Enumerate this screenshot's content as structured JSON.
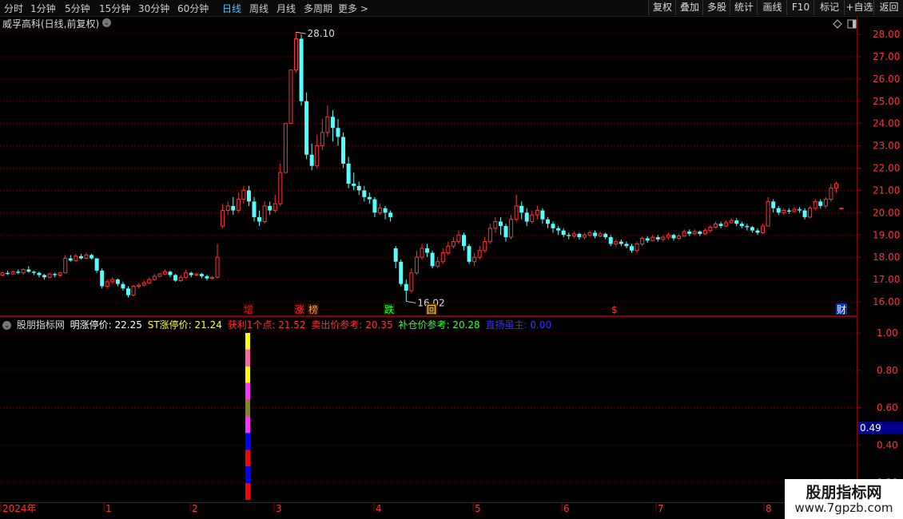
{
  "toolbar": {
    "timeframes": [
      "分时",
      "1分钟",
      "5分钟",
      "15分钟",
      "30分钟",
      "60分钟",
      "日线",
      "周线",
      "月线",
      "多周期",
      "更多"
    ],
    "active_timeframe": "日线",
    "more_arrow": ">",
    "buttons": [
      "复权",
      "叠加",
      "多股",
      "统计",
      "画线",
      "F10",
      "标记",
      "+自选",
      "返回"
    ]
  },
  "header": {
    "stock_title": "威孚高科(日线,前复权)",
    "dropdown_glyph": "⌄",
    "diamond_icon": "diamond-icon",
    "panel_icon": "panel-icon"
  },
  "price_axis": {
    "labels": [
      "28.00",
      "27.00",
      "26.00",
      "25.00",
      "24.00",
      "23.00",
      "22.00",
      "21.00",
      "20.00",
      "19.00",
      "18.00",
      "17.00",
      "16.00"
    ],
    "range": [
      15.5,
      28.6
    ]
  },
  "annotations": {
    "high_label": "28.10",
    "low_label": "16.02",
    "event_marks": [
      {
        "text": "增",
        "color": "#cc2222",
        "bg": "#2a0000"
      },
      {
        "text": "涨",
        "color": "#ff3333",
        "bg": "#2a0000"
      },
      {
        "text": "榜",
        "color": "#ff9944",
        "bg": "#2a1000"
      },
      {
        "text": "跌",
        "color": "#33ff33",
        "bg": "#002a00"
      },
      {
        "text": "回",
        "color": "#ffcc66",
        "bg": "#553300"
      },
      {
        "text": "$",
        "color": "#ff3333",
        "bg": "#000000"
      },
      {
        "text": "财",
        "color": "#ffffff",
        "bg": "#0033cc"
      }
    ]
  },
  "indicator": {
    "name": "股朋指标网",
    "items": [
      {
        "label": "明涨停价: 22.25",
        "color": "#ffffff"
      },
      {
        "label": "ST涨停价: 21.24",
        "color": "#ffff33"
      },
      {
        "label": "获利1个点: 21.52",
        "color": "#ff3333"
      },
      {
        "label": "卖出价参考: 20.35",
        "color": "#ff3333"
      },
      {
        "label": "补仓价参考: 20.28",
        "color": "#33ff33"
      },
      {
        "label": "直扬虽主: 0.00",
        "color": "#3333ff"
      }
    ],
    "axis_labels": [
      "1.00",
      "0.80",
      "0.60",
      "0.40",
      "0.20"
    ],
    "current_value": "0.49",
    "bar_colors": [
      "#ffff00",
      "#ff66aa",
      "#ffff00",
      "#ff33ff",
      "#888822",
      "#ff33ff",
      "#0000ff",
      "#ff0000",
      "#0000ff",
      "#ff0000"
    ]
  },
  "time_axis": {
    "labels": [
      "2024年",
      "1",
      "2",
      "3",
      "4",
      "5",
      "6",
      "7",
      "8"
    ]
  },
  "chart_data": {
    "type": "candlestick",
    "ylim": [
      15.5,
      28.6
    ],
    "candles": [
      {
        "o": 17.2,
        "c": 17.3,
        "h": 17.35,
        "l": 17.15
      },
      {
        "o": 17.3,
        "c": 17.25,
        "h": 17.4,
        "l": 17.2
      },
      {
        "o": 17.25,
        "c": 17.35,
        "h": 17.4,
        "l": 17.2
      },
      {
        "o": 17.35,
        "c": 17.3,
        "h": 17.45,
        "l": 17.25
      },
      {
        "o": 17.3,
        "c": 17.45,
        "h": 17.5,
        "l": 17.2
      },
      {
        "o": 17.45,
        "c": 17.35,
        "h": 17.6,
        "l": 17.3
      },
      {
        "o": 17.35,
        "c": 17.3,
        "h": 17.4,
        "l": 17.2
      },
      {
        "o": 17.3,
        "c": 17.2,
        "h": 17.35,
        "l": 17.1
      },
      {
        "o": 17.2,
        "c": 17.1,
        "h": 17.25,
        "l": 17.0
      },
      {
        "o": 17.1,
        "c": 17.25,
        "h": 17.3,
        "l": 17.05
      },
      {
        "o": 17.25,
        "c": 17.2,
        "h": 17.3,
        "l": 17.1
      },
      {
        "o": 17.2,
        "c": 17.3,
        "h": 17.35,
        "l": 17.1
      },
      {
        "o": 17.3,
        "c": 17.95,
        "h": 18.1,
        "l": 17.3
      },
      {
        "o": 17.95,
        "c": 17.85,
        "h": 18.1,
        "l": 17.8
      },
      {
        "o": 17.85,
        "c": 18.05,
        "h": 18.15,
        "l": 17.8
      },
      {
        "o": 18.05,
        "c": 17.95,
        "h": 18.15,
        "l": 17.9
      },
      {
        "o": 17.95,
        "c": 18.1,
        "h": 18.2,
        "l": 17.9
      },
      {
        "o": 18.1,
        "c": 17.95,
        "h": 18.15,
        "l": 17.9
      },
      {
        "o": 17.95,
        "c": 17.4,
        "h": 17.95,
        "l": 17.3
      },
      {
        "o": 17.4,
        "c": 16.7,
        "h": 17.5,
        "l": 16.6
      },
      {
        "o": 16.7,
        "c": 16.9,
        "h": 17.0,
        "l": 16.6
      },
      {
        "o": 16.9,
        "c": 17.0,
        "h": 17.1,
        "l": 16.8
      },
      {
        "o": 17.0,
        "c": 16.8,
        "h": 17.05,
        "l": 16.7
      },
      {
        "o": 16.8,
        "c": 16.6,
        "h": 16.9,
        "l": 16.5
      },
      {
        "o": 16.6,
        "c": 16.3,
        "h": 16.7,
        "l": 16.2
      },
      {
        "o": 16.3,
        "c": 16.7,
        "h": 16.75,
        "l": 16.25
      },
      {
        "o": 16.7,
        "c": 16.75,
        "h": 16.85,
        "l": 16.6
      },
      {
        "o": 16.75,
        "c": 16.85,
        "h": 16.95,
        "l": 16.7
      },
      {
        "o": 16.85,
        "c": 17.0,
        "h": 17.1,
        "l": 16.8
      },
      {
        "o": 17.0,
        "c": 17.15,
        "h": 17.25,
        "l": 16.95
      },
      {
        "o": 17.15,
        "c": 17.25,
        "h": 17.3,
        "l": 17.1
      },
      {
        "o": 17.25,
        "c": 17.35,
        "h": 17.45,
        "l": 17.2
      },
      {
        "o": 17.35,
        "c": 17.2,
        "h": 17.4,
        "l": 17.1
      },
      {
        "o": 17.2,
        "c": 16.95,
        "h": 17.25,
        "l": 16.9
      },
      {
        "o": 16.95,
        "c": 17.1,
        "h": 17.2,
        "l": 16.9
      },
      {
        "o": 17.1,
        "c": 17.3,
        "h": 17.45,
        "l": 17.05
      },
      {
        "o": 17.3,
        "c": 17.2,
        "h": 17.35,
        "l": 17.1
      },
      {
        "o": 17.2,
        "c": 17.25,
        "h": 17.3,
        "l": 17.15
      },
      {
        "o": 17.25,
        "c": 17.15,
        "h": 17.3,
        "l": 17.05
      },
      {
        "o": 17.15,
        "c": 17.05,
        "h": 17.2,
        "l": 16.95
      },
      {
        "o": 17.05,
        "c": 17.1,
        "h": 17.15,
        "l": 17.0
      },
      {
        "o": 17.1,
        "c": 18.0,
        "h": 18.6,
        "l": 17.05
      },
      {
        "o": 19.4,
        "c": 20.1,
        "h": 20.4,
        "l": 19.3
      },
      {
        "o": 20.1,
        "c": 20.3,
        "h": 20.5,
        "l": 19.9
      },
      {
        "o": 20.3,
        "c": 20.1,
        "h": 20.7,
        "l": 19.9
      },
      {
        "o": 20.1,
        "c": 20.6,
        "h": 20.9,
        "l": 20.0
      },
      {
        "o": 20.6,
        "c": 21.0,
        "h": 21.2,
        "l": 20.4
      },
      {
        "o": 21.0,
        "c": 20.5,
        "h": 21.2,
        "l": 20.3
      },
      {
        "o": 20.5,
        "c": 19.8,
        "h": 20.7,
        "l": 19.6
      },
      {
        "o": 19.8,
        "c": 19.6,
        "h": 20.1,
        "l": 19.4
      },
      {
        "o": 19.6,
        "c": 20.3,
        "h": 20.5,
        "l": 19.5
      },
      {
        "o": 20.3,
        "c": 20.1,
        "h": 20.5,
        "l": 19.9
      },
      {
        "o": 20.1,
        "c": 20.4,
        "h": 20.8,
        "l": 20.0
      },
      {
        "o": 20.4,
        "c": 21.8,
        "h": 22.2,
        "l": 20.3
      },
      {
        "o": 21.8,
        "c": 24.0,
        "h": 24.0,
        "l": 21.8
      },
      {
        "o": 24.0,
        "c": 26.4,
        "h": 26.4,
        "l": 24.0
      },
      {
        "o": 26.4,
        "c": 27.8,
        "h": 28.1,
        "l": 26.3
      },
      {
        "o": 27.8,
        "c": 25.0,
        "h": 28.0,
        "l": 24.8
      },
      {
        "o": 25.0,
        "c": 22.6,
        "h": 25.4,
        "l": 22.4
      },
      {
        "o": 22.6,
        "c": 22.1,
        "h": 23.1,
        "l": 21.9
      },
      {
        "o": 22.1,
        "c": 23.0,
        "h": 23.5,
        "l": 22.0
      },
      {
        "o": 23.0,
        "c": 23.6,
        "h": 24.2,
        "l": 22.8
      },
      {
        "o": 23.6,
        "c": 24.3,
        "h": 24.8,
        "l": 23.4
      },
      {
        "o": 24.3,
        "c": 23.8,
        "h": 24.6,
        "l": 23.2
      },
      {
        "o": 23.8,
        "c": 23.4,
        "h": 24.2,
        "l": 23.0
      },
      {
        "o": 23.4,
        "c": 22.2,
        "h": 23.6,
        "l": 22.0
      },
      {
        "o": 22.2,
        "c": 21.3,
        "h": 22.5,
        "l": 21.1
      },
      {
        "o": 21.3,
        "c": 21.2,
        "h": 21.8,
        "l": 21.0
      },
      {
        "o": 21.2,
        "c": 21.0,
        "h": 21.4,
        "l": 20.8
      },
      {
        "o": 21.0,
        "c": 20.7,
        "h": 21.2,
        "l": 20.5
      },
      {
        "o": 20.7,
        "c": 20.6,
        "h": 20.9,
        "l": 20.4
      },
      {
        "o": 20.6,
        "c": 20.0,
        "h": 20.7,
        "l": 19.8
      },
      {
        "o": 20.0,
        "c": 20.2,
        "h": 20.4,
        "l": 19.9
      },
      {
        "o": 20.2,
        "c": 20.0,
        "h": 20.3,
        "l": 19.7
      },
      {
        "o": 20.0,
        "c": 19.8,
        "h": 20.1,
        "l": 19.6
      },
      {
        "o": 18.4,
        "c": 17.8,
        "h": 18.5,
        "l": 17.5
      },
      {
        "o": 17.8,
        "c": 16.8,
        "h": 17.9,
        "l": 16.7
      },
      {
        "o": 16.8,
        "c": 16.5,
        "h": 17.0,
        "l": 16.02
      },
      {
        "o": 16.5,
        "c": 17.3,
        "h": 17.5,
        "l": 16.4
      },
      {
        "o": 17.3,
        "c": 18.0,
        "h": 18.3,
        "l": 17.2
      },
      {
        "o": 18.0,
        "c": 18.4,
        "h": 18.6,
        "l": 17.9
      },
      {
        "o": 18.4,
        "c": 18.2,
        "h": 18.6,
        "l": 18.0
      },
      {
        "o": 18.2,
        "c": 17.6,
        "h": 18.3,
        "l": 17.5
      },
      {
        "o": 17.6,
        "c": 17.8,
        "h": 18.0,
        "l": 17.5
      },
      {
        "o": 17.8,
        "c": 18.2,
        "h": 18.4,
        "l": 17.7
      },
      {
        "o": 18.2,
        "c": 18.5,
        "h": 18.7,
        "l": 18.1
      },
      {
        "o": 18.5,
        "c": 18.7,
        "h": 18.9,
        "l": 18.4
      },
      {
        "o": 18.7,
        "c": 19.0,
        "h": 19.2,
        "l": 18.6
      },
      {
        "o": 19.0,
        "c": 18.5,
        "h": 19.1,
        "l": 18.3
      },
      {
        "o": 18.5,
        "c": 17.8,
        "h": 18.6,
        "l": 17.7
      },
      {
        "o": 17.8,
        "c": 18.0,
        "h": 18.2,
        "l": 17.6
      },
      {
        "o": 18.0,
        "c": 18.3,
        "h": 18.5,
        "l": 17.9
      },
      {
        "o": 18.3,
        "c": 18.7,
        "h": 18.9,
        "l": 18.2
      },
      {
        "o": 18.7,
        "c": 19.3,
        "h": 19.5,
        "l": 18.6
      },
      {
        "o": 19.3,
        "c": 19.6,
        "h": 19.8,
        "l": 19.1
      },
      {
        "o": 19.6,
        "c": 19.4,
        "h": 19.8,
        "l": 19.0
      },
      {
        "o": 19.4,
        "c": 18.9,
        "h": 19.5,
        "l": 18.7
      },
      {
        "o": 18.9,
        "c": 19.7,
        "h": 19.9,
        "l": 18.8
      },
      {
        "o": 19.7,
        "c": 20.3,
        "h": 20.8,
        "l": 19.6
      },
      {
        "o": 20.3,
        "c": 20.0,
        "h": 20.5,
        "l": 19.7
      },
      {
        "o": 20.0,
        "c": 19.6,
        "h": 20.2,
        "l": 19.4
      },
      {
        "o": 19.6,
        "c": 19.9,
        "h": 20.1,
        "l": 19.5
      },
      {
        "o": 19.9,
        "c": 20.1,
        "h": 20.3,
        "l": 19.7
      },
      {
        "o": 20.1,
        "c": 19.7,
        "h": 20.2,
        "l": 19.5
      },
      {
        "o": 19.7,
        "c": 19.5,
        "h": 19.8,
        "l": 19.3
      },
      {
        "o": 19.5,
        "c": 19.3,
        "h": 19.6,
        "l": 19.1
      },
      {
        "o": 19.3,
        "c": 19.2,
        "h": 19.4,
        "l": 19.0
      },
      {
        "o": 19.2,
        "c": 19.0,
        "h": 19.3,
        "l": 18.9
      },
      {
        "o": 19.0,
        "c": 18.95,
        "h": 19.1,
        "l": 18.8
      },
      {
        "o": 18.95,
        "c": 19.05,
        "h": 19.15,
        "l": 18.85
      },
      {
        "o": 19.05,
        "c": 18.9,
        "h": 19.1,
        "l": 18.8
      },
      {
        "o": 18.9,
        "c": 19.0,
        "h": 19.1,
        "l": 18.8
      },
      {
        "o": 19.0,
        "c": 19.1,
        "h": 19.2,
        "l": 18.9
      },
      {
        "o": 19.1,
        "c": 18.95,
        "h": 19.2,
        "l": 18.85
      },
      {
        "o": 18.95,
        "c": 19.05,
        "h": 19.15,
        "l": 18.9
      },
      {
        "o": 19.05,
        "c": 18.9,
        "h": 19.1,
        "l": 18.8
      },
      {
        "o": 18.9,
        "c": 18.6,
        "h": 19.0,
        "l": 18.5
      },
      {
        "o": 18.6,
        "c": 18.7,
        "h": 18.8,
        "l": 18.5
      },
      {
        "o": 18.7,
        "c": 18.6,
        "h": 18.8,
        "l": 18.5
      },
      {
        "o": 18.6,
        "c": 18.5,
        "h": 18.7,
        "l": 18.4
      },
      {
        "o": 18.5,
        "c": 18.3,
        "h": 18.6,
        "l": 18.2
      },
      {
        "o": 18.3,
        "c": 18.6,
        "h": 18.7,
        "l": 18.2
      },
      {
        "o": 18.6,
        "c": 18.85,
        "h": 18.95,
        "l": 18.5
      },
      {
        "o": 18.85,
        "c": 18.75,
        "h": 18.95,
        "l": 18.65
      },
      {
        "o": 18.75,
        "c": 18.9,
        "h": 19.0,
        "l": 18.7
      },
      {
        "o": 18.9,
        "c": 18.8,
        "h": 19.0,
        "l": 18.7
      },
      {
        "o": 18.8,
        "c": 18.9,
        "h": 19.0,
        "l": 18.7
      },
      {
        "o": 18.9,
        "c": 19.0,
        "h": 19.1,
        "l": 18.8
      },
      {
        "o": 19.0,
        "c": 18.85,
        "h": 19.05,
        "l": 18.75
      },
      {
        "o": 18.85,
        "c": 18.95,
        "h": 19.05,
        "l": 18.8
      },
      {
        "o": 18.95,
        "c": 19.15,
        "h": 19.25,
        "l": 18.9
      },
      {
        "o": 19.15,
        "c": 19.05,
        "h": 19.25,
        "l": 18.95
      },
      {
        "o": 19.05,
        "c": 19.15,
        "h": 19.25,
        "l": 19.0
      },
      {
        "o": 19.15,
        "c": 19.05,
        "h": 19.2,
        "l": 18.95
      },
      {
        "o": 19.05,
        "c": 19.2,
        "h": 19.3,
        "l": 19.0
      },
      {
        "o": 19.2,
        "c": 19.35,
        "h": 19.45,
        "l": 19.1
      },
      {
        "o": 19.35,
        "c": 19.5,
        "h": 19.6,
        "l": 19.3
      },
      {
        "o": 19.5,
        "c": 19.4,
        "h": 19.6,
        "l": 19.3
      },
      {
        "o": 19.4,
        "c": 19.55,
        "h": 19.65,
        "l": 19.35
      },
      {
        "o": 19.55,
        "c": 19.65,
        "h": 19.75,
        "l": 19.5
      },
      {
        "o": 19.65,
        "c": 19.5,
        "h": 19.75,
        "l": 19.4
      },
      {
        "o": 19.5,
        "c": 19.4,
        "h": 19.6,
        "l": 19.3
      },
      {
        "o": 19.4,
        "c": 19.35,
        "h": 19.5,
        "l": 19.2
      },
      {
        "o": 19.35,
        "c": 19.2,
        "h": 19.4,
        "l": 19.1
      },
      {
        "o": 19.2,
        "c": 19.1,
        "h": 19.3,
        "l": 19.0
      },
      {
        "o": 19.1,
        "c": 19.4,
        "h": 19.5,
        "l": 19.05
      },
      {
        "o": 19.4,
        "c": 20.5,
        "h": 20.7,
        "l": 19.4
      },
      {
        "o": 20.5,
        "c": 20.2,
        "h": 20.6,
        "l": 20.0
      },
      {
        "o": 20.2,
        "c": 20.0,
        "h": 20.3,
        "l": 19.9
      },
      {
        "o": 20.0,
        "c": 20.1,
        "h": 20.2,
        "l": 19.9
      },
      {
        "o": 20.1,
        "c": 20.05,
        "h": 20.2,
        "l": 19.95
      },
      {
        "o": 20.05,
        "c": 20.15,
        "h": 20.25,
        "l": 20.0
      },
      {
        "o": 20.15,
        "c": 20.1,
        "h": 20.25,
        "l": 20.0
      },
      {
        "o": 20.1,
        "c": 19.8,
        "h": 20.2,
        "l": 19.7
      },
      {
        "o": 19.8,
        "c": 20.2,
        "h": 20.3,
        "l": 19.75
      },
      {
        "o": 20.2,
        "c": 20.5,
        "h": 20.6,
        "l": 20.1
      },
      {
        "o": 20.5,
        "c": 20.3,
        "h": 20.6,
        "l": 20.2
      },
      {
        "o": 20.3,
        "c": 20.6,
        "h": 20.7,
        "l": 20.2
      },
      {
        "o": 20.6,
        "c": 21.1,
        "h": 21.3,
        "l": 20.5
      },
      {
        "o": 21.1,
        "c": 21.3,
        "h": 21.4,
        "l": 20.9
      },
      {
        "o": 20.2,
        "c": 20.2,
        "h": 20.2,
        "l": 20.2
      }
    ],
    "indicator_bars": [
      1.0,
      0.0
    ]
  }
}
